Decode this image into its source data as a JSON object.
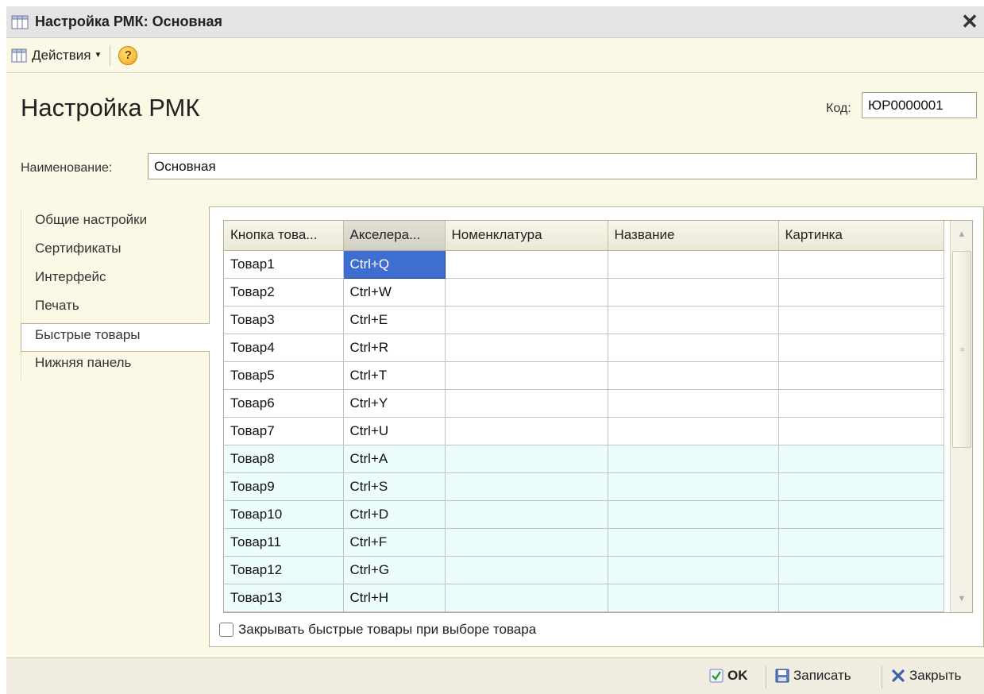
{
  "window": {
    "title": "Настройка РМК: Основная",
    "close_glyph": "✕",
    "icon": "table-icon"
  },
  "toolbar": {
    "actions_label": "Действия",
    "help_label": "?"
  },
  "form": {
    "heading": "Настройка РМК",
    "code_label": "Код:",
    "code_value": "ЮР0000001",
    "name_label": "Наименование:",
    "name_value": "Основная"
  },
  "tabs": [
    {
      "label": "Общие настройки"
    },
    {
      "label": "Сертификаты"
    },
    {
      "label": "Интерфейс"
    },
    {
      "label": "Печать"
    },
    {
      "label": "Быстрые товары"
    },
    {
      "label": "Нижняя панель"
    }
  ],
  "grid": {
    "columns": [
      "Кнопка това...",
      "Акселера...",
      "Номенклатура",
      "Название",
      "Картинка"
    ],
    "rows": [
      [
        "Товар1",
        "Ctrl+Q",
        "",
        "",
        ""
      ],
      [
        "Товар2",
        "Ctrl+W",
        "",
        "",
        ""
      ],
      [
        "Товар3",
        "Ctrl+E",
        "",
        "",
        ""
      ],
      [
        "Товар4",
        "Ctrl+R",
        "",
        "",
        ""
      ],
      [
        "Товар5",
        "Ctrl+T",
        "",
        "",
        ""
      ],
      [
        "Товар6",
        "Ctrl+Y",
        "",
        "",
        ""
      ],
      [
        "Товар7",
        "Ctrl+U",
        "",
        "",
        ""
      ],
      [
        "Товар8",
        "Ctrl+A",
        "",
        "",
        ""
      ],
      [
        "Товар9",
        "Ctrl+S",
        "",
        "",
        ""
      ],
      [
        "Товар10",
        "Ctrl+D",
        "",
        "",
        ""
      ],
      [
        "Товар11",
        "Ctrl+F",
        "",
        "",
        ""
      ],
      [
        "Товар12",
        "Ctrl+G",
        "",
        "",
        ""
      ],
      [
        "Товар13",
        "Ctrl+H",
        "",
        "",
        ""
      ]
    ],
    "selected_cell": "Ctrl+Q"
  },
  "checkbox": {
    "label": "Закрывать быстрые товары при выборе товара",
    "checked": false
  },
  "buttons": {
    "ok": "OK",
    "save": "Записать",
    "close": "Закрыть"
  },
  "colors": {
    "accent_selection": "#3e6fd0",
    "form_bg": "#fbf8e6",
    "alt_row": "#ecfdfd"
  }
}
